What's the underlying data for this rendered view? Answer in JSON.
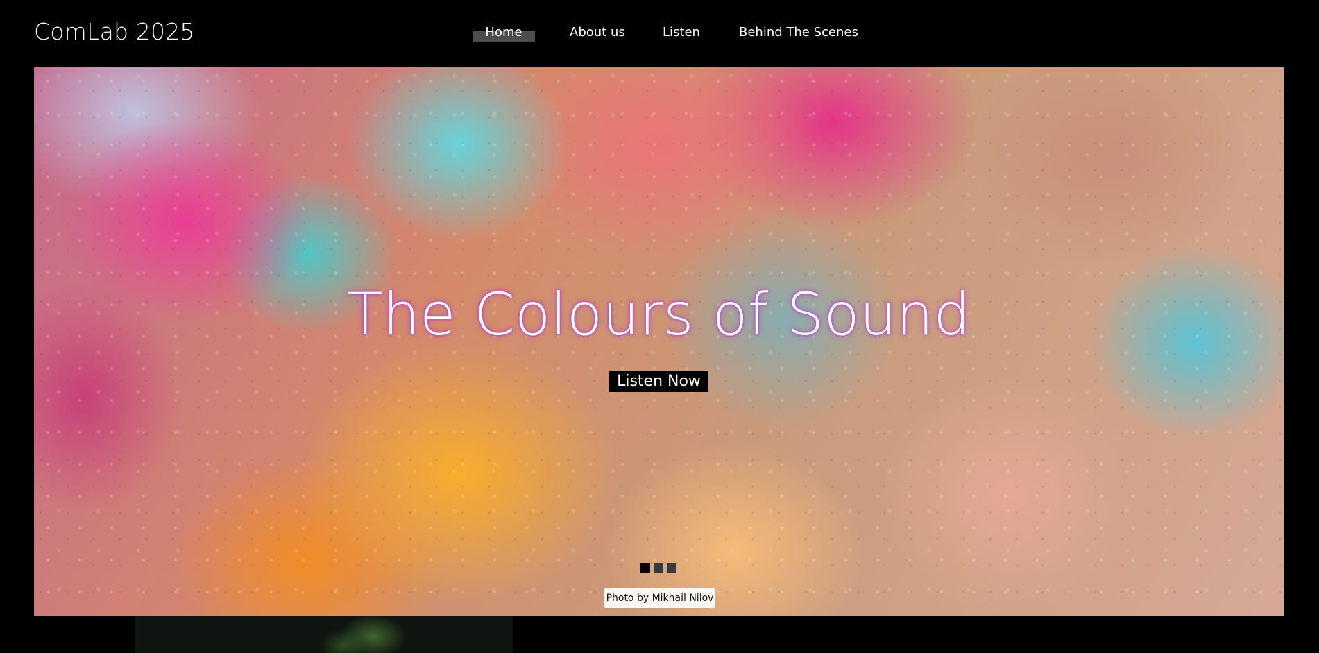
{
  "header": {
    "site_title": "ComLab 2025",
    "nav": [
      {
        "label": "Home",
        "active": true
      },
      {
        "label": "About us",
        "active": false
      },
      {
        "label": "Listen",
        "active": false
      },
      {
        "label": "Behind The Scenes",
        "active": false
      }
    ]
  },
  "hero": {
    "title": "The Colours of Sound",
    "cta_label": "Listen Now",
    "slides": {
      "count": 3,
      "active_index": 0
    },
    "photo_credit": "Photo by Mikhail Nilov",
    "background": "rain-drops-on-glass-over-colorful-flowers"
  },
  "colors": {
    "page_background": "#000000",
    "text": "#ffffff",
    "active_nav_indicator": "#4d4d4d",
    "title_glow": "#be3cdc",
    "cta_background": "#000000"
  }
}
